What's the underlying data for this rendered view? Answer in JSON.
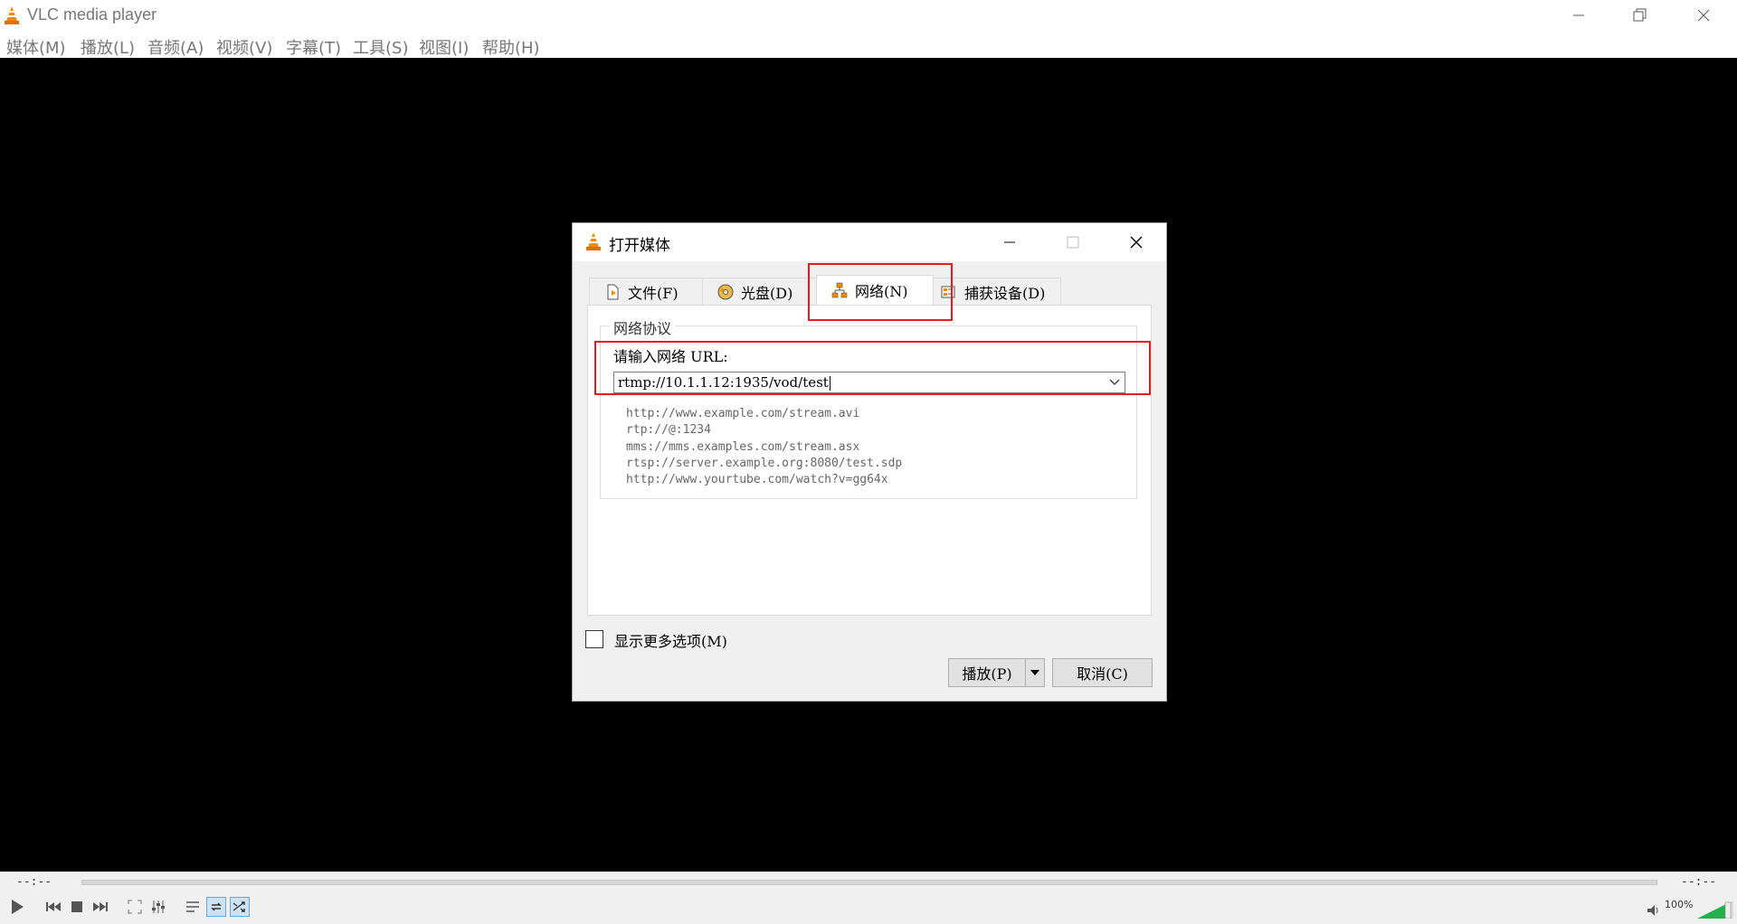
{
  "window": {
    "title": "VLC media player"
  },
  "menu": [
    "媒体(M)",
    "播放(L)",
    "音频(A)",
    "视频(V)",
    "字幕(T)",
    "工具(S)",
    "视图(I)",
    "帮助(H)"
  ],
  "dialog": {
    "title": "打开媒体",
    "tabs": [
      {
        "label": "文件(F)",
        "icon": "file-icon"
      },
      {
        "label": "光盘(D)",
        "icon": "disc-icon"
      },
      {
        "label": "网络(N)",
        "icon": "network-icon",
        "active": true
      },
      {
        "label": "捕获设备(D)",
        "icon": "capture-device-icon"
      }
    ],
    "group_label": "网络协议",
    "url_label": "请输入网络 URL:",
    "url_value": "rtmp://10.1.1.12:1935/vod/test",
    "examples": [
      "http://www.example.com/stream.avi",
      "rtp://@:1234",
      "mms://mms.examples.com/stream.asx",
      "rtsp://server.example.org:8080/test.sdp",
      "http://www.yourtube.com/watch?v=gg64x"
    ],
    "show_more_label": "显示更多选项(M)",
    "show_more_checked": false,
    "play_label": "播放(P)",
    "cancel_label": "取消(C)"
  },
  "controls": {
    "elapsed": "--:--",
    "remaining": "--:--",
    "volume": "100%"
  },
  "colors": {
    "highlight": "#e81b23",
    "vlc_orange": "#f08a00"
  }
}
